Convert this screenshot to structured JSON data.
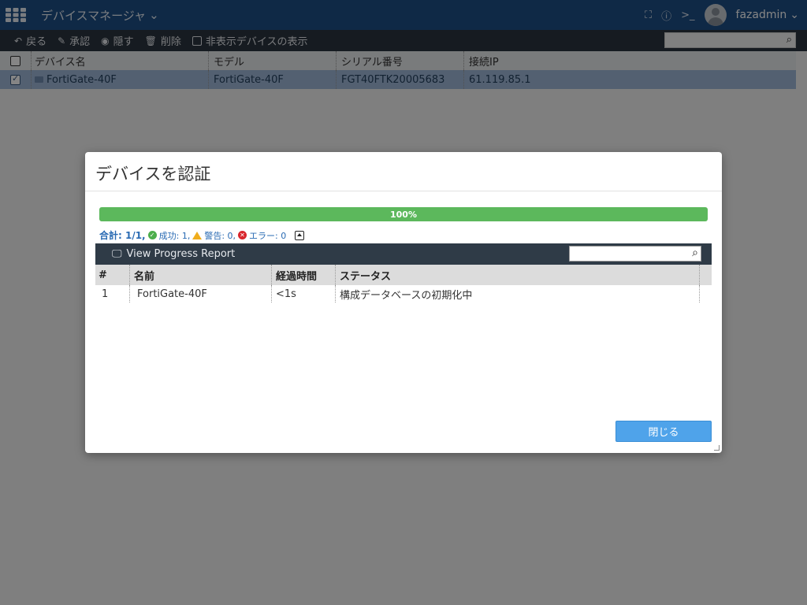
{
  "topbar": {
    "title": "デバイスマネージャ",
    "username": "fazadmin"
  },
  "toolbar": {
    "back": "戻る",
    "approve": "承認",
    "hide": "隠す",
    "delete": "削除",
    "show_hidden": "非表示デバイスの表示"
  },
  "device_table": {
    "headers": [
      "デバイス名",
      "モデル",
      "シリアル番号",
      "接続IP"
    ],
    "rows": [
      {
        "name": "FortiGate-40F",
        "model": "FortiGate-40F",
        "serial": "FGT40FTK20005683",
        "ip": "61.119.85.1"
      }
    ]
  },
  "dialog": {
    "title": "デバイスを認証",
    "progress_label": "100%",
    "progress_value": 100,
    "summary": {
      "total": "合計: 1/1,",
      "success": "成功: 1,",
      "warning": "警告: 0,",
      "error": "エラー: 0"
    },
    "report_title": "View Progress Report",
    "table": {
      "headers": [
        "#",
        "名前",
        "経過時間",
        "ステータス"
      ],
      "rows": [
        {
          "num": "1",
          "name": "FortiGate-40F",
          "elapsed": "<1s",
          "status": "構成データベースの初期化中"
        }
      ]
    },
    "close_label": "閉じる"
  },
  "colors": {
    "topbar": "#1e4f86",
    "toolbar": "#2b3540",
    "progress": "#5cb85c",
    "primary_button": "#4fa3ea"
  }
}
